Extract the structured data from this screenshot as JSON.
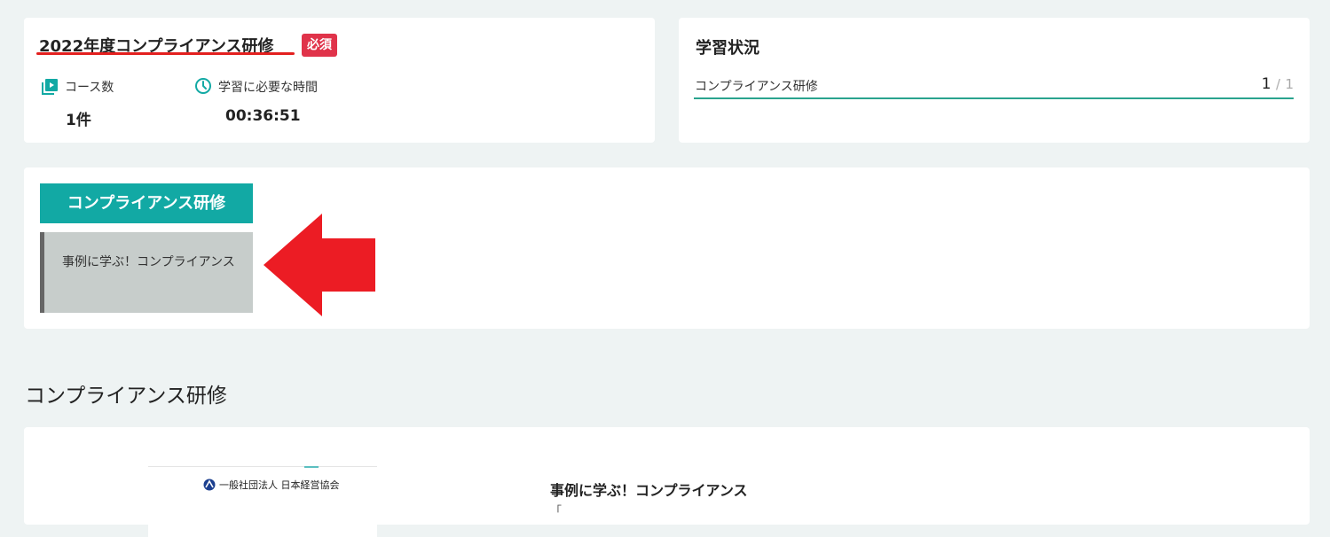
{
  "overview": {
    "title": "2022年度コンプライアンス研修",
    "badge": "必須",
    "course_count_label": "コース数",
    "course_count_value": "1件",
    "time_label": "学習に必要な時間",
    "time_value": "00:36:51",
    "icons": [
      "video-list-icon",
      "clock-icon"
    ]
  },
  "status": {
    "title": "学習状況",
    "row_label": "コンプライアンス研修",
    "completed": "1",
    "separator": "/",
    "total": "1"
  },
  "course_list": {
    "tab_label": "コンプライアンス研修",
    "lessons": [
      {
        "label": "事例に学ぶ！コンプライアンス"
      }
    ]
  },
  "section": {
    "title": "コンプライアンス研修"
  },
  "detail": {
    "thumbnail_org": "一般社団法人 日本経営協会",
    "lesson_title": "事例に学ぶ！コンプライアンス",
    "description_partial": "「"
  },
  "colors": {
    "teal": "#12a9a4",
    "badge_red": "#e0334a",
    "annotation_red": "#ec1c24",
    "progress_line": "#2aa38e",
    "page_bg": "#eef3f3"
  }
}
